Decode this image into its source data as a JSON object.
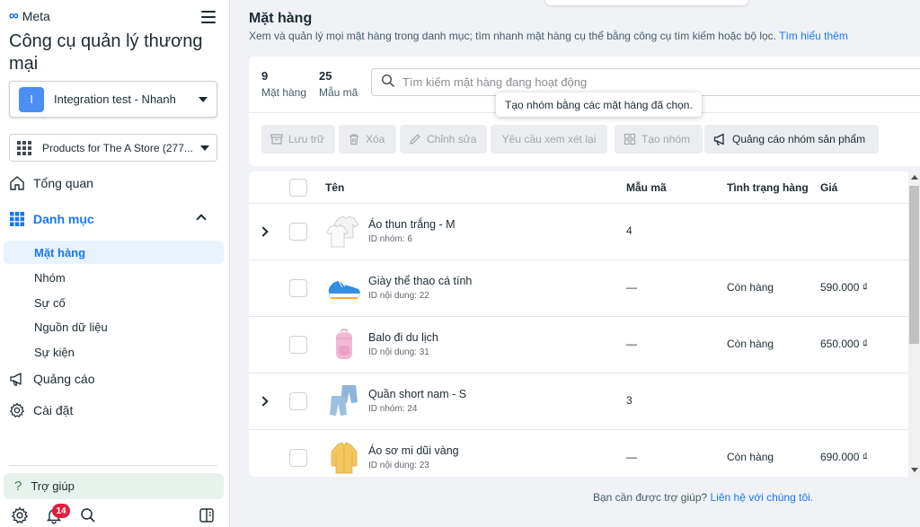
{
  "sidebar": {
    "brand": "Meta",
    "app_title": "Công cụ quản lý thương mại",
    "account": {
      "badge": "I",
      "name": "Integration test - Nhanh"
    },
    "catalog": {
      "name": "Products for The A Store (277..."
    },
    "nav": {
      "overview": "Tổng quan",
      "catalog": "Danh mục",
      "ads": "Quảng cáo",
      "settings": "Cài đặt"
    },
    "sub_items": [
      "Mặt hàng",
      "Nhóm",
      "Sự cố",
      "Nguồn dữ liệu",
      "Sự kiện"
    ],
    "help": "Trợ giúp",
    "notification_count": "14"
  },
  "main": {
    "title": "Mặt hàng",
    "description": "Xem và quản lý mọi mặt hàng trong danh mục; tìm nhanh mặt hàng cụ thể bằng công cụ tìm kiếm hoặc bộ lọc.",
    "learn_more": "Tìm hiểu thêm",
    "stats": [
      {
        "num": "9",
        "label": "Mặt hàng"
      },
      {
        "num": "25",
        "label": "Mẫu mã"
      }
    ],
    "search_placeholder": "Tìm kiếm mặt hàng đang hoạt động",
    "tooltip": "Tạo nhóm bằng các mặt hàng đã chọn.",
    "toolbar": {
      "archive": "Lưu trữ",
      "delete": "Xóa",
      "edit": "Chỉnh sửa",
      "review": "Yêu cầu xem xét lại",
      "create_group": "Tạo nhóm",
      "advertise_group": "Quảng cáo nhóm sản phẩm"
    },
    "table": {
      "headers": {
        "name": "Tên",
        "variants": "Mẫu mã",
        "status": "Tình trạng hàng",
        "price": "Giá"
      },
      "rows": [
        {
          "name": "Áo thun trắng - M",
          "id": "ID nhóm: 6",
          "variants": "4",
          "status": "",
          "price": "",
          "expandable": true,
          "thumb": "tshirt-image"
        },
        {
          "name": "Giày thể thao cá tính",
          "id": "ID nội dung: 22",
          "variants": "—",
          "status": "Còn hàng",
          "price": "590.000 ₫",
          "expandable": false,
          "thumb": "sneaker-image"
        },
        {
          "name": "Balo đi du lịch",
          "id": "ID nội dung: 31",
          "variants": "—",
          "status": "Còn hàng",
          "price": "650.000 ₫",
          "expandable": false,
          "thumb": "backpack-image"
        },
        {
          "name": "Quần short nam - S",
          "id": "ID nhóm: 24",
          "variants": "3",
          "status": "",
          "price": "",
          "expandable": true,
          "thumb": "shorts-image"
        },
        {
          "name": "Áo sơ mi dũi vàng",
          "id": "ID nội dung: 23",
          "variants": "—",
          "status": "Còn hàng",
          "price": "690.000 ₫",
          "expandable": false,
          "thumb": "shirt-image"
        }
      ]
    },
    "footer_help": "Bạn cần được trợ giúp?",
    "footer_link": "Liên hệ với chúng tôi."
  },
  "colors": {
    "accent": "#1877f2",
    "active_bg": "#e7f3ff",
    "help_bg": "#e6f2ec",
    "badge": "#e41e3f"
  }
}
